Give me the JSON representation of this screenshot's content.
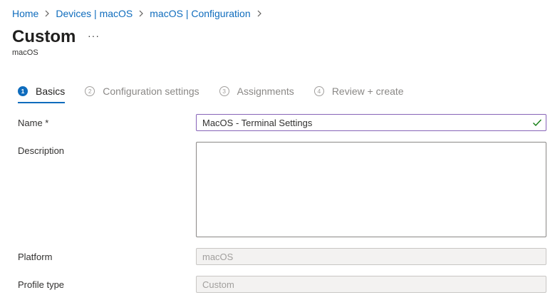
{
  "breadcrumb": {
    "items": [
      "Home",
      "Devices | macOS",
      "macOS | Configuration"
    ]
  },
  "header": {
    "title": "Custom",
    "more_label": "···",
    "subtitle": "macOS"
  },
  "wizard": {
    "steps": [
      {
        "number": "1",
        "label": "Basics",
        "active": true
      },
      {
        "number": "2",
        "label": "Configuration settings",
        "active": false
      },
      {
        "number": "3",
        "label": "Assignments",
        "active": false
      },
      {
        "number": "4",
        "label": "Review + create",
        "active": false
      }
    ]
  },
  "form": {
    "name_label": "Name *",
    "name_value": "MacOS - Terminal Settings",
    "description_label": "Description",
    "description_value": "",
    "platform_label": "Platform",
    "platform_value": "macOS",
    "profile_type_label": "Profile type",
    "profile_type_value": "Custom"
  },
  "colors": {
    "link": "#0f6cbd",
    "accent": "#0f6cbd",
    "valid_check": "#107c10",
    "focus_border": "#8764b8"
  },
  "icons": {
    "breadcrumb_separator": "chevron-right-icon",
    "valid": "checkmark-icon",
    "more": "more-icon"
  }
}
